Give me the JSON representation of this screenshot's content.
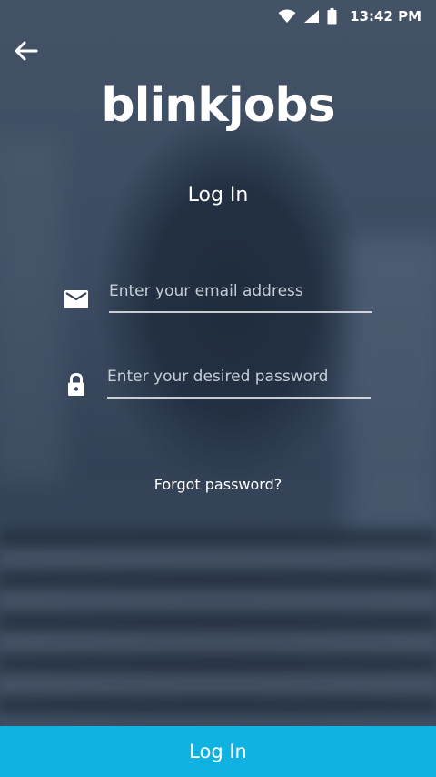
{
  "status_bar": {
    "time": "13:42 PM",
    "icons": [
      "wifi-icon",
      "cell-signal-icon",
      "battery-icon"
    ]
  },
  "header": {
    "back_icon": "arrow-left-icon"
  },
  "brand": {
    "logo_text": "blinkjobs"
  },
  "page": {
    "title": "Log In"
  },
  "form": {
    "email": {
      "icon": "mail-icon",
      "value": "",
      "placeholder": "Enter your email address"
    },
    "password": {
      "icon": "lock-icon",
      "value": "",
      "placeholder": "Enter your desired password"
    },
    "forgot_label": "Forgot password?"
  },
  "footer": {
    "submit_label": "Log In"
  },
  "colors": {
    "accent": "#0fb2e0",
    "text": "#ffffff"
  }
}
